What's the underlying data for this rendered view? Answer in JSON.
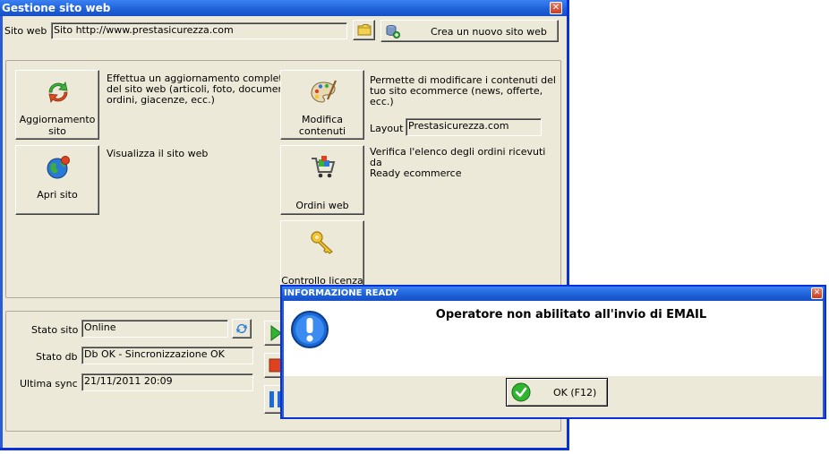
{
  "window": {
    "title": "Gestione sito web",
    "close": "✕"
  },
  "site": {
    "label": "Sito web :",
    "value": "Sito http://www.prestasicurezza.com",
    "new_site_button": "Crea un nuovo sito web"
  },
  "actions": {
    "update": {
      "label": "Aggiornamento\nsito",
      "description": "Effettua un aggiornamento completo\ndel sito web (articoli, foto, documenti,\nordini, giacenze, ecc.)"
    },
    "open": {
      "label": "Apri sito",
      "description": "Visualizza il sito web"
    },
    "edit": {
      "label": "Modifica\ncontenuti",
      "description": "Permette di modificare i contenuti del\ntuo sito ecommerce (news, offerte, ecc.)"
    },
    "orders": {
      "label": "Ordini web",
      "description": "Verifica l'elenco degli ordini ricevuti da\nReady ecommerce"
    },
    "license": {
      "label": "Controllo licenza"
    }
  },
  "layout_field": {
    "label": "Layout :",
    "value": "Prestasicurezza.com"
  },
  "status": {
    "site_label": "Stato sito :",
    "site_value": "Online",
    "db_label": "Stato db :",
    "db_value": "Db OK - Sincronizzazione OK",
    "sync_label": "Ultima sync :",
    "sync_value": "21/11/2011 20:09"
  },
  "dialog": {
    "title": "INFORMAZIONE READY",
    "message": "Operatore non abilitato all'invio di EMAIL",
    "ok_button": "OK (F12)",
    "close": "✕"
  },
  "colors": {
    "title_bar": "#1e5fd6",
    "window_face": "#ece9d8",
    "play": "#2fb52f",
    "stop": "#e0411f",
    "pause": "#1c6ad8"
  }
}
